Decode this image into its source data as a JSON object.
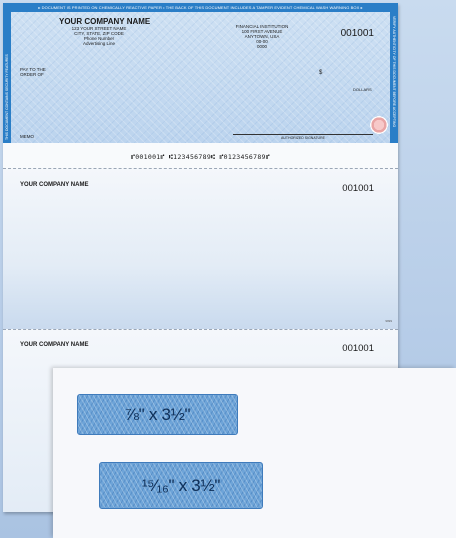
{
  "check": {
    "top_warning": "▸ DOCUMENT IS PRINTED ON CHEMICALLY REACTIVE PAPER • THE BACK OF THIS DOCUMENT INCLUDES A TAMPER EVIDENT CHEMICAL WASH WARNING BOX ▸",
    "side_left_text": "THIS DOCUMENT CONTAINS SECURITY FEATURES",
    "side_right_text": "VERIFY AUTHENTICITY OF THIS DOCUMENT BEFORE ACCEPTING",
    "company_name": "YOUR COMPANY NAME",
    "company_lines": [
      "123 YOUR STREET NAME",
      "CITY, STATE, ZIP CODE",
      "Phone Number",
      "Advertising Line"
    ],
    "bank_lines": [
      "FINANCIAL INSTITUTION",
      "100 FIRST AVENUE",
      "ANYTOWN, USA",
      "00-00",
      "0000"
    ],
    "check_number": "001001",
    "pay_to_label_1": "PAY TO THE",
    "pay_to_label_2": "ORDER  OF",
    "dollar_sign": "$",
    "dollars_label": "DOLLARS",
    "memo_label": "MEMO",
    "signature_label": "AUTHORIZED SIGNATURE"
  },
  "micr_line": "⑈001001⑈  ⑆123456789⑆  ⑈0123456789⑈",
  "stub1": {
    "company_name": "YOUR COMPANY NAME",
    "check_number": "001001",
    "form_code": "9999"
  },
  "stub2": {
    "company_name": "YOUR COMPANY NAME",
    "check_number": "001001"
  },
  "envelope": {
    "window1_label": "⅞\" x 3½\"",
    "window2_label": "¹⁵⁄₁₆\" x 3½\""
  }
}
